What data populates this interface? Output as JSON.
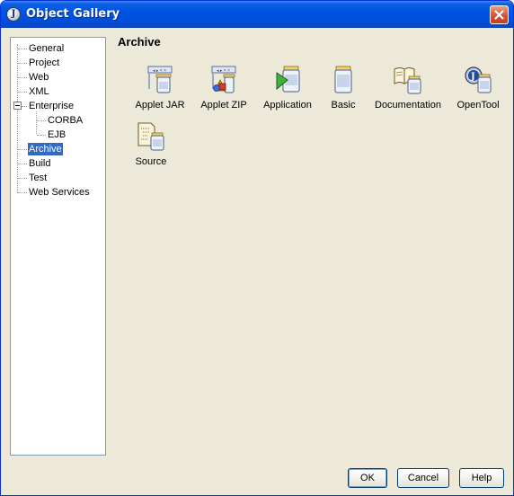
{
  "window": {
    "title": "Object Gallery"
  },
  "tree": {
    "items": [
      {
        "label": "General"
      },
      {
        "label": "Project"
      },
      {
        "label": "Web"
      },
      {
        "label": "XML"
      },
      {
        "label": "Enterprise",
        "expanded": true
      },
      {
        "label": "CORBA"
      },
      {
        "label": "EJB"
      },
      {
        "label": "Archive",
        "selected": true
      },
      {
        "label": "Build"
      },
      {
        "label": "Test"
      },
      {
        "label": "Web Services"
      }
    ]
  },
  "main": {
    "title": "Archive",
    "items": [
      {
        "label": "Applet JAR",
        "icon": "applet-jar-icon"
      },
      {
        "label": "Applet ZIP",
        "icon": "applet-zip-icon"
      },
      {
        "label": "Application",
        "icon": "application-jar-icon"
      },
      {
        "label": "Basic",
        "icon": "basic-jar-icon"
      },
      {
        "label": "Documentation",
        "icon": "documentation-jar-icon"
      },
      {
        "label": "OpenTool",
        "icon": "opentool-jar-icon"
      },
      {
        "label": "Source",
        "icon": "source-jar-icon"
      }
    ]
  },
  "buttons": {
    "ok": "OK",
    "cancel": "Cancel",
    "help": "Help"
  },
  "colors": {
    "titlebar": "#0054e3",
    "selection": "#316ac5",
    "dialog": "#ece9d8"
  }
}
